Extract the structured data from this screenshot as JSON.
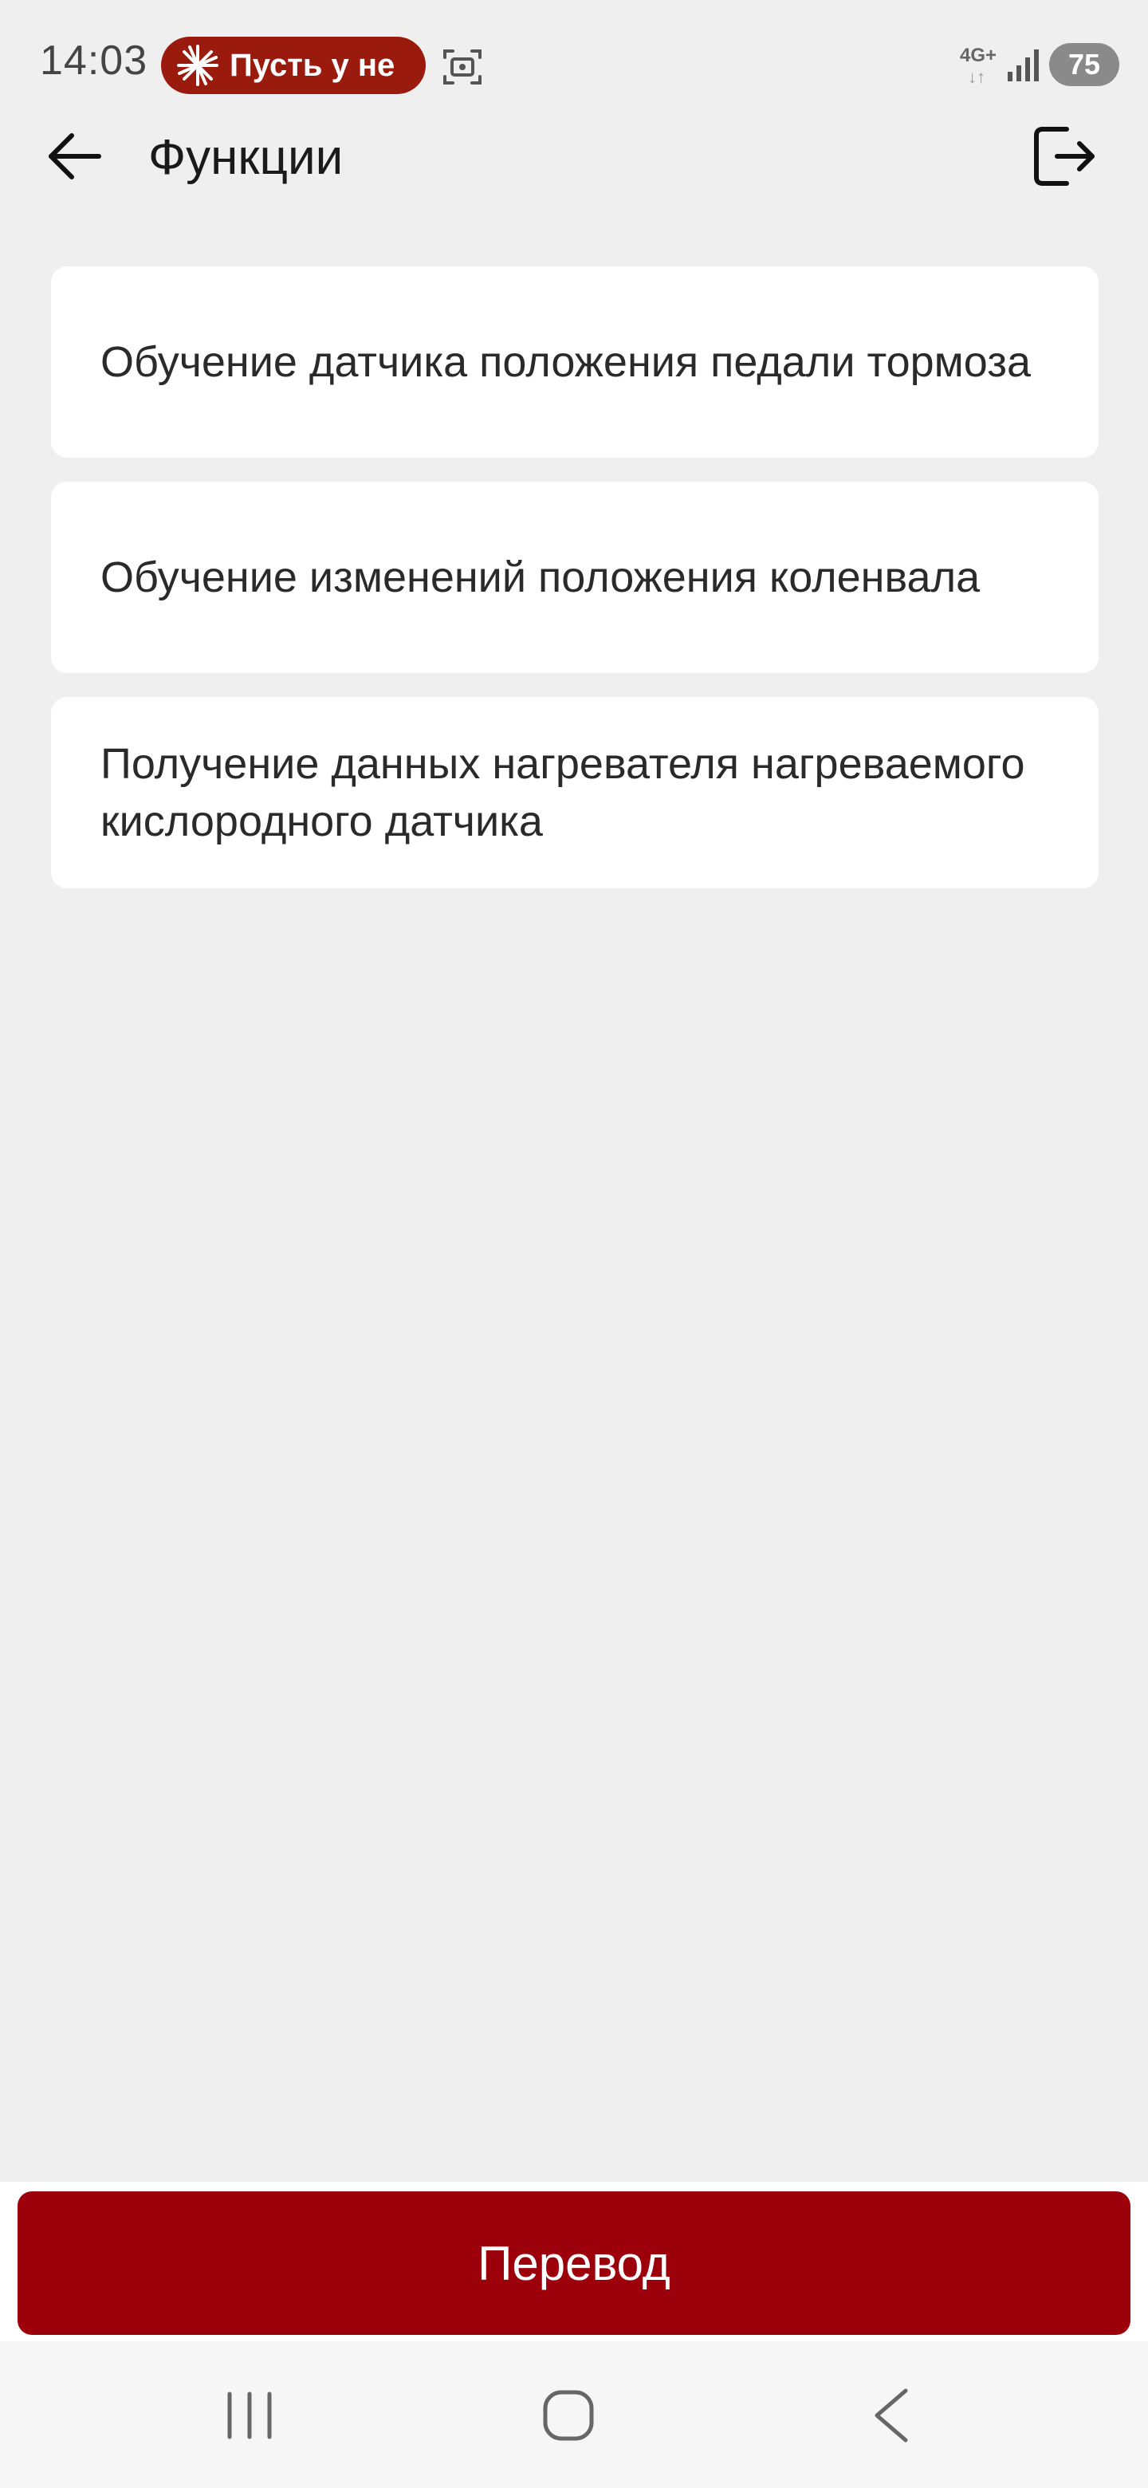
{
  "status_bar": {
    "time": "14:03",
    "notification_text": "Пусть у не",
    "network": "4G+",
    "network_arrows": "↓↑",
    "battery": "75"
  },
  "header": {
    "title": "Функции"
  },
  "functions": [
    {
      "label": "Обучение датчика положения педали тормоза"
    },
    {
      "label": "Обучение изменений положения коленвала"
    },
    {
      "label": "Получение данных нагревателя нагреваемого кислородного датчика"
    }
  ],
  "footer": {
    "translate_label": "Перевод"
  },
  "icons": {
    "back": "arrow-left-icon",
    "logout": "logout-icon",
    "screenshot": "screenshot-icon",
    "nav_recent": "recent-apps-icon",
    "nav_home": "home-icon",
    "nav_back": "back-chevron-icon"
  },
  "colors": {
    "accent": "#9c000b",
    "background": "#efefef",
    "card": "#ffffff",
    "notification": "#9a1b0e"
  }
}
